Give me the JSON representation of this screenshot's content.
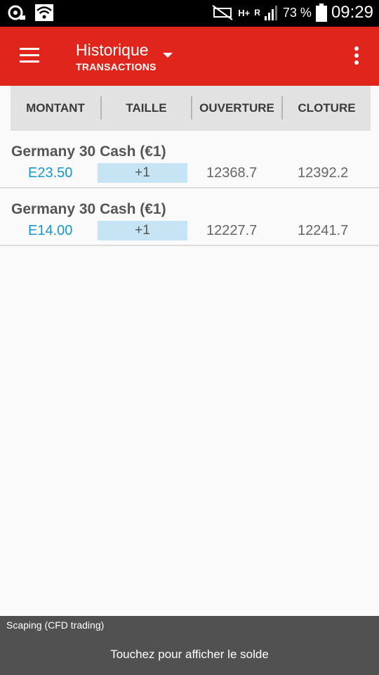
{
  "status_bar": {
    "battery_percent": "73 %",
    "time": "09:29",
    "network_type": "H+",
    "roaming": "R",
    "icons": [
      "notification-icon",
      "wifi-icon",
      "mute-icon",
      "signal-icon",
      "battery-icon"
    ]
  },
  "app_bar": {
    "title": "Historique",
    "subtitle": "TRANSACTIONS",
    "colors": {
      "background": "#e0261c"
    }
  },
  "columns": [
    "MONTANT",
    "TAILLE",
    "OUVERTURE",
    "CLOTURE"
  ],
  "transactions": [
    {
      "instrument": "Germany 30 Cash (€1)",
      "amount": "E23.50",
      "size": "+1",
      "open": "12368.7",
      "close": "12392.2"
    },
    {
      "instrument": "Germany 30 Cash (€1)",
      "amount": "E14.00",
      "size": "+1",
      "open": "12227.7",
      "close": "12241.7"
    }
  ],
  "footer": {
    "account": "Scaping (CFD trading)",
    "message": "Touchez pour afficher le solde"
  },
  "colors": {
    "amount": "#1796d2",
    "size_bg": "#c6e4f4"
  }
}
